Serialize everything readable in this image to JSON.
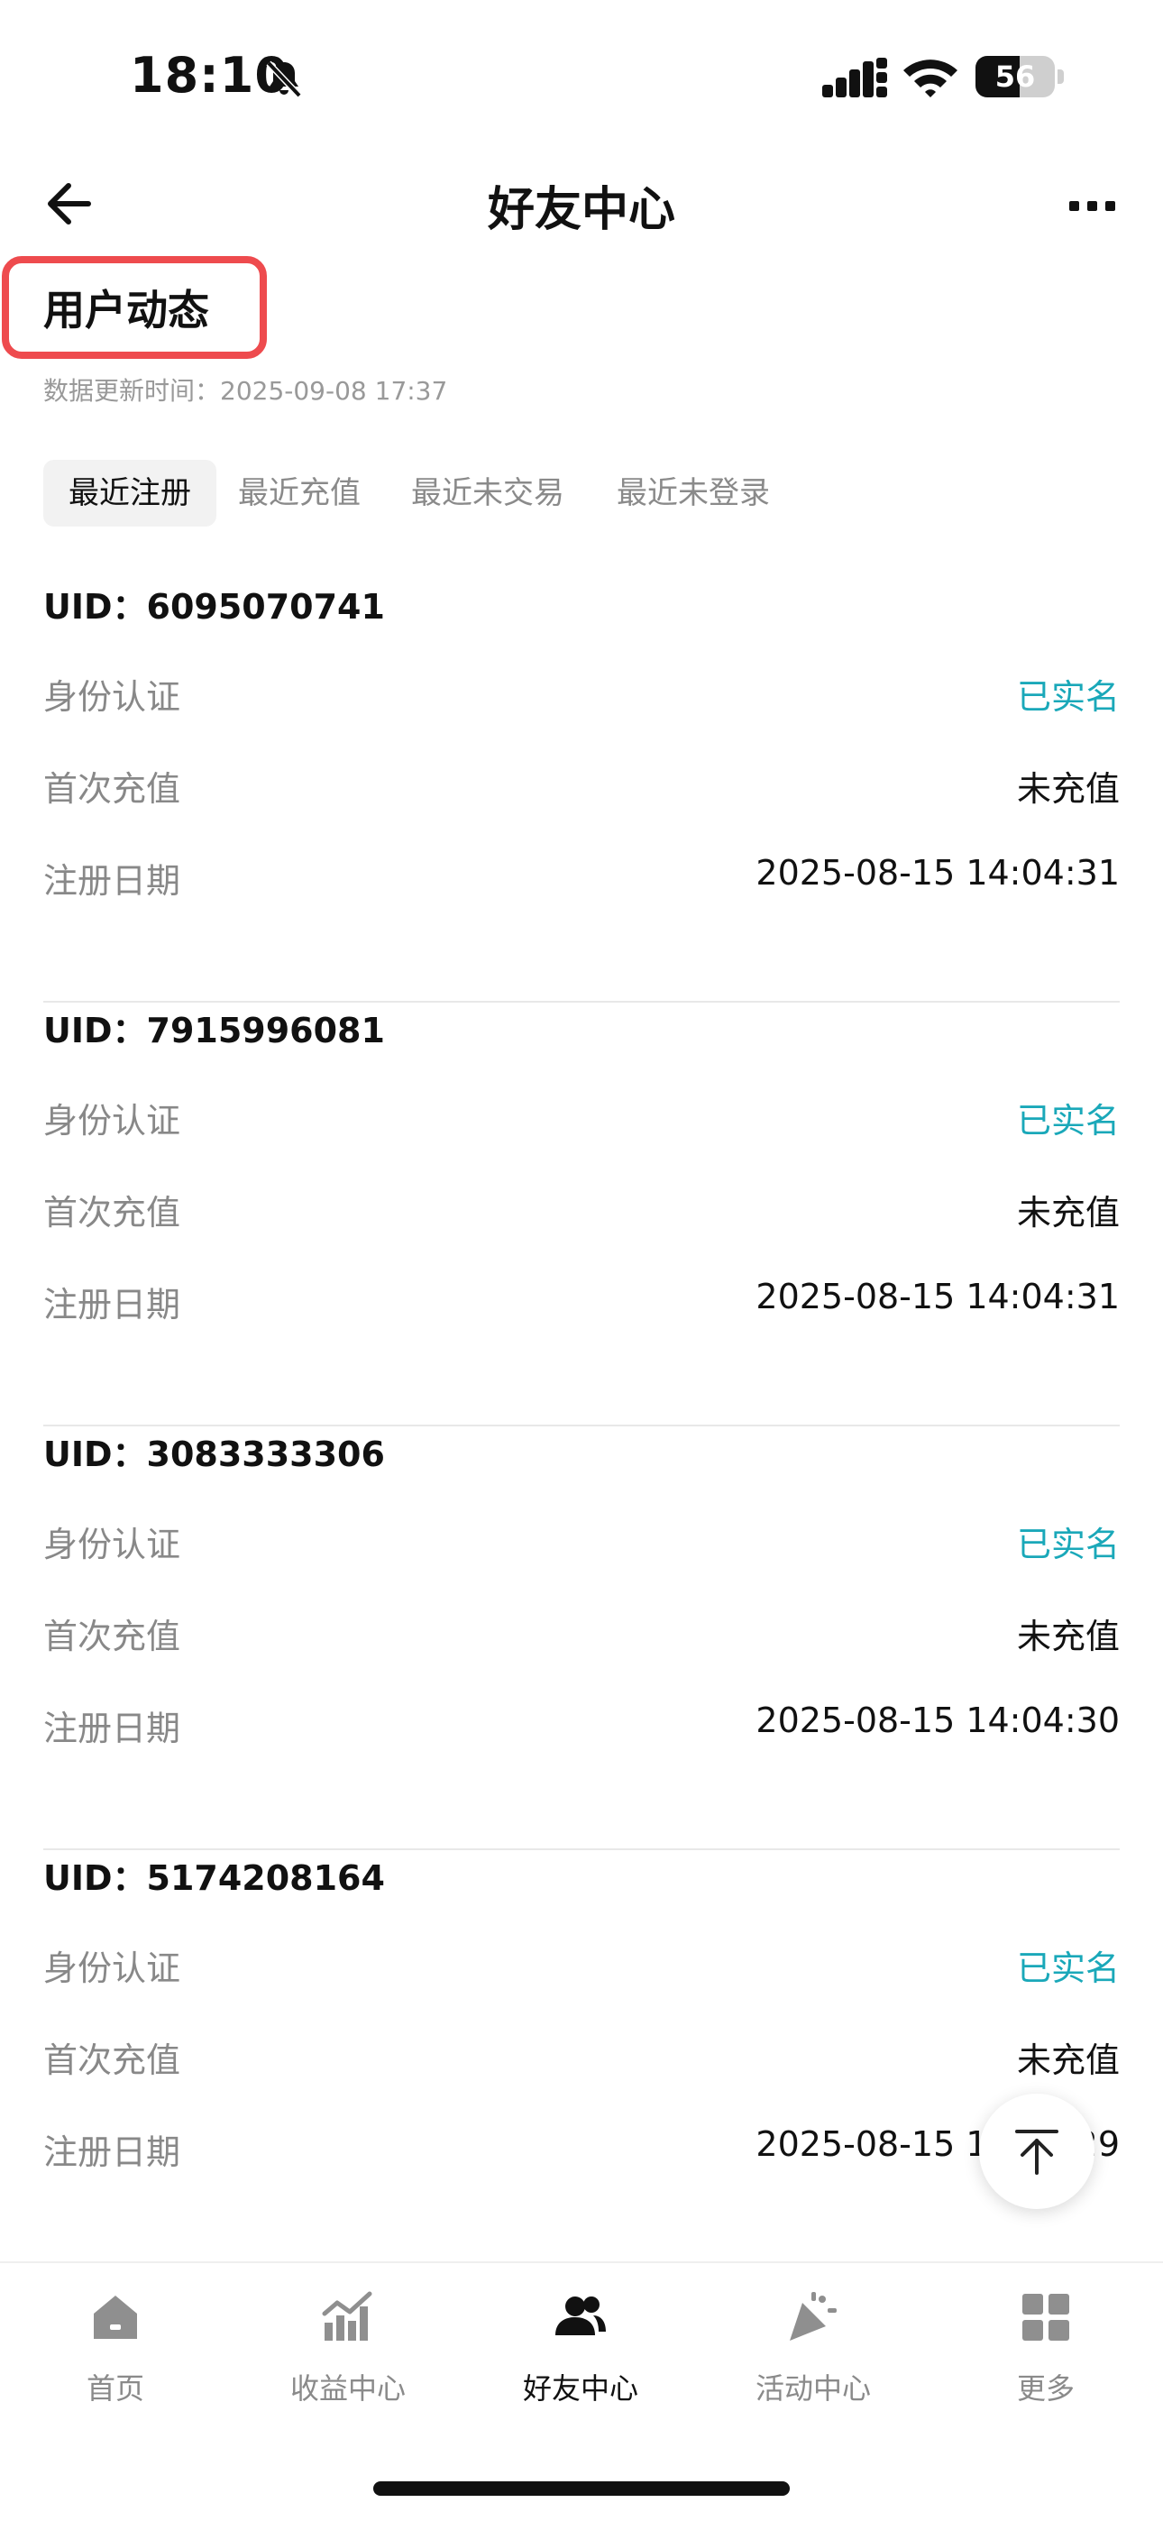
{
  "status_bar": {
    "time": "18:10",
    "battery": "56",
    "battery_level": 0.56
  },
  "nav": {
    "title": "好友中心"
  },
  "section": {
    "title": "用户动态",
    "update_time": "数据更新时间：2025-09-08 17:37"
  },
  "tabs": [
    {
      "label": "最近注册",
      "active": true
    },
    {
      "label": "最近充值",
      "active": false
    },
    {
      "label": "最近未交易",
      "active": false
    },
    {
      "label": "最近未登录",
      "active": false
    }
  ],
  "records": [
    {
      "uid": "UID：6095070741",
      "identity_label": "身份认证",
      "identity_value": "已实名",
      "deposit_label": "首次充值",
      "deposit_value": "未充值",
      "register_label": "注册日期",
      "register_value": "2025-08-15 14:04:31"
    },
    {
      "uid": "UID：7915996081",
      "identity_label": "身份认证",
      "identity_value": "已实名",
      "deposit_label": "首次充值",
      "deposit_value": "未充值",
      "register_label": "注册日期",
      "register_value": "2025-08-15 14:04:31"
    },
    {
      "uid": "UID：3083333306",
      "identity_label": "身份认证",
      "identity_value": "已实名",
      "deposit_label": "首次充值",
      "deposit_value": "未充值",
      "register_label": "注册日期",
      "register_value": "2025-08-15 14:04:30"
    },
    {
      "uid": "UID：5174208164",
      "identity_label": "身份认证",
      "identity_value": "已实名",
      "deposit_label": "首次充值",
      "deposit_value": "未充值",
      "register_label": "注册日期",
      "register_value": "2025-08-15 14:04:29"
    }
  ],
  "tabbar": [
    {
      "label": "首页",
      "icon": "home-icon",
      "active": false
    },
    {
      "label": "收益中心",
      "icon": "chart-icon",
      "active": false
    },
    {
      "label": "好友中心",
      "icon": "friends-icon",
      "active": true
    },
    {
      "label": "活动中心",
      "icon": "party-icon",
      "active": false
    },
    {
      "label": "更多",
      "icon": "grid-icon",
      "active": false
    }
  ],
  "colors": {
    "accent": "#1aa8b9",
    "highlight_border": "#ee4b4e",
    "muted_text": "#888888"
  }
}
